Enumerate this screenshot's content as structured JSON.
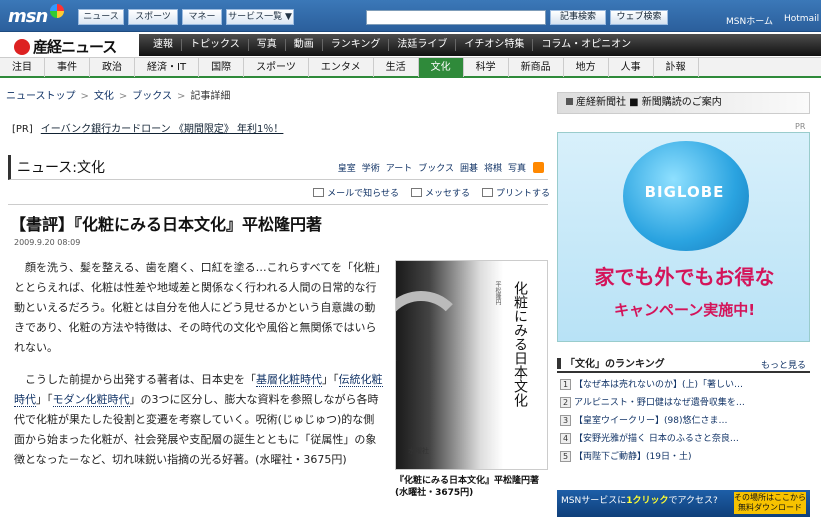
{
  "msn": {
    "logo": "msn",
    "tabs": [
      "ニュース",
      "スポーツ",
      "マネー",
      "サービス一覧 ▼"
    ],
    "search_btn1": "記事検索",
    "search_btn2": "ウェブ検索",
    "link_home": "MSNホーム",
    "link_hotmail": "Hotmail"
  },
  "sankei": {
    "logo": "産経ニュース",
    "nav": [
      "速報",
      "トピックス",
      "写真",
      "動画",
      "ランキング",
      "法廷ライブ",
      "イチオシ特集",
      "コラム・オピニオン"
    ],
    "subnav": [
      "注目",
      "事件",
      "政治",
      "経済・IT",
      "国際",
      "スポーツ",
      "エンタメ",
      "生活",
      "文化",
      "科学",
      "新商品",
      "地方",
      "人事",
      "訃報"
    ],
    "subnav_active": "文化"
  },
  "breadcrumb": [
    "ニューストップ",
    "文化",
    "ブックス",
    "記事詳細"
  ],
  "pr": {
    "tag": "[PR]",
    "text": "イーバンク銀行カードローン 《期間限定》 年利1％！"
  },
  "section": {
    "title": "ニュース:文化",
    "cats": [
      "皇室",
      "学術",
      "アート",
      "ブックス",
      "囲碁",
      "将棋",
      "写真"
    ]
  },
  "tools": {
    "mail": "メールで知らせる",
    "messenger": "メッセする",
    "print": "プリントする"
  },
  "article": {
    "headline": "【書評】『化粧にみる日本文化』平松隆円著",
    "date": "2009.9.20 08:09",
    "p1": "顔を洗う、髪を整える、歯を磨く、口紅を塗る…これらすべてを「化粧」ととらえれば、化粧は性差や地域差と関係なく行われる人間の日常的な行動といえるだろう。化粧とは自分を他人にどう見せるかという自意識の動きであり、化粧の方法や特徴は、その時代の文化や風俗と無関係ではいられない。",
    "p2a": "こうした前提から出発する著者は、日本史を「",
    "k1": "基層化粧時代",
    "p2b": "」「",
    "k2": "伝統化粧時代",
    "p2c": "」「",
    "k3": "モダン化粧時代",
    "p2d": "」の3つに区分し、膨大な資料を参照しながら各時代で化粧が果たした役割と変遷を考察していく。呪術(じゅじゅつ)的な側面から始まった化粧が、社会発展や支配層の誕生とともに「従属性」の象徴となった－など、切れ味鋭い指摘の光る好著。(水曜社・3675円)"
  },
  "book": {
    "title": "化粧にみる日本文化",
    "author": "平松隆円",
    "publisher": "水曜社",
    "caption": "『化粧にみる日本文化』平松隆円著(水曜社・3675円)"
  },
  "right": {
    "header": "産経新聞社 ■ 新聞購読のご案内",
    "pr": "PR",
    "ad": {
      "globe": "BIGLOBE",
      "line1": "家でも外でもお得な",
      "line2": "キャンペーン実施中!"
    },
    "ranking_title": "「文化」のランキング",
    "ranking_more": "もっと見る",
    "ranking": [
      {
        "n": "1",
        "t": "【なぜ本は売れないのか】(上)「著しい…"
      },
      {
        "n": "2",
        "t": "アルピニスト・野口健はなぜ遺骨収集を…"
      },
      {
        "n": "3",
        "t": "【皇室ウイークリー】(98)悠仁さま…"
      },
      {
        "n": "4",
        "t": "【安野光雅が描く 日本のふるさと奈良…"
      },
      {
        "n": "5",
        "t": "【両陛下ご動静】(19日・土)"
      }
    ],
    "service": {
      "a": "MSNサービスに",
      "b": "1クリック",
      "c": "でアクセス?",
      "dl": "その場所はここから無料ダウンロード"
    }
  }
}
